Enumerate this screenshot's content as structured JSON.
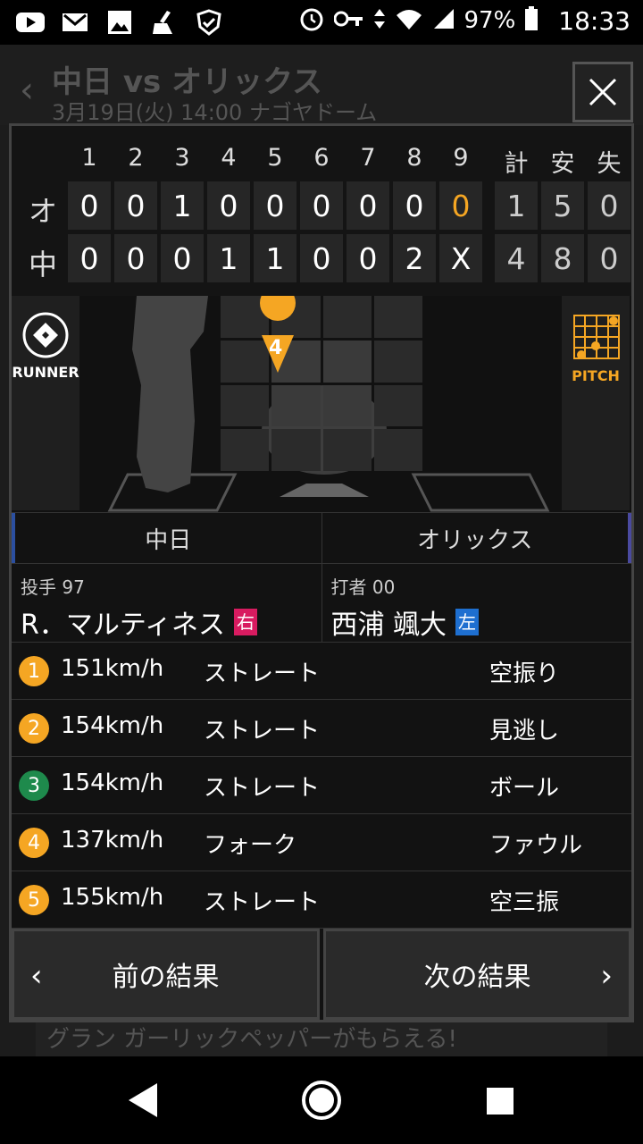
{
  "status": {
    "battery": "97%",
    "time": "18:33"
  },
  "bg_header": {
    "title": "中日 vs オリックス",
    "subtitle": "3月19日(火) 14:00 ナゴヤドーム"
  },
  "scoreboard": {
    "innings": [
      "1",
      "2",
      "3",
      "4",
      "5",
      "6",
      "7",
      "8",
      "9"
    ],
    "totals_headers": [
      "計",
      "安",
      "失"
    ],
    "teams": [
      {
        "abbr": "オ",
        "scores": [
          "0",
          "0",
          "1",
          "0",
          "0",
          "0",
          "0",
          "0",
          "0"
        ],
        "totals": [
          "1",
          "5",
          "0"
        ]
      },
      {
        "abbr": "中",
        "scores": [
          "0",
          "0",
          "0",
          "1",
          "1",
          "0",
          "0",
          "2",
          "X"
        ],
        "totals": [
          "4",
          "8",
          "0"
        ]
      }
    ]
  },
  "field": {
    "runner_label": "RUNNER",
    "pitch_label": "PITCH",
    "marker_label": "4"
  },
  "teams": {
    "home": "中日",
    "away": "オリックス"
  },
  "pitcher": {
    "role": "投手 97",
    "name": "R．マルティネス",
    "hand": "右"
  },
  "batter": {
    "role": "打者 00",
    "name": "西浦 颯大",
    "hand": "左"
  },
  "pitches": [
    {
      "num": "1",
      "speed": "151km/h",
      "type": "ストレート",
      "result": "空振り",
      "color": "#f5a623"
    },
    {
      "num": "2",
      "speed": "154km/h",
      "type": "ストレート",
      "result": "見逃し",
      "color": "#f5a623"
    },
    {
      "num": "3",
      "speed": "154km/h",
      "type": "ストレート",
      "result": "ボール",
      "color": "#1e8a4c"
    },
    {
      "num": "4",
      "speed": "137km/h",
      "type": "フォーク",
      "result": "ファウル",
      "color": "#f5a623"
    },
    {
      "num": "5",
      "speed": "155km/h",
      "type": "ストレート",
      "result": "空三振",
      "color": "#f5a623"
    }
  ],
  "nav": {
    "prev": "前の結果",
    "next": "次の結果"
  },
  "banner": "グラン ガーリックペッパーがもらえる!"
}
